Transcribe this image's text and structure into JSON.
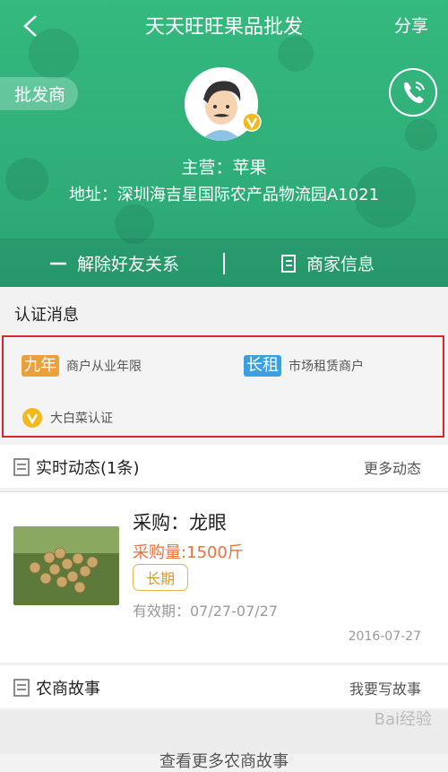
{
  "header": {
    "title": "天天旺旺果品批发",
    "share_label": "分享",
    "role_badge": "批发商",
    "main_business": "主营：苹果",
    "address": "地址：深圳海吉星国际农产品物流园A1021",
    "actions": [
      {
        "label": "解除好友关系",
        "icon": "minus-icon"
      },
      {
        "label": "商家信息",
        "icon": "document-icon"
      }
    ],
    "bg_color": "#2fae79"
  },
  "certification": {
    "title": "认证消息",
    "items": [
      {
        "tag": "九年",
        "label": "商户从业年限",
        "tag_color": "#e9a23b"
      },
      {
        "tag": "长租",
        "label": "市场租赁商户",
        "tag_color": "#3c9fe0"
      },
      {
        "tag": "",
        "label": "大白菜认证",
        "icon": "verified-v-icon"
      }
    ]
  },
  "feed": {
    "title": "实时动态(1条)",
    "more_label": "更多动态",
    "post": {
      "title": "采购：龙眼",
      "quantity": "采购量:1500斤",
      "term": "长期",
      "validity": "有效期：07/27-07/27",
      "date": "2016-07-27"
    }
  },
  "story": {
    "title": "农商故事",
    "write_label": "我要写故事",
    "more_stories": "查看更多农商故事"
  },
  "watermark": "Bai经验"
}
